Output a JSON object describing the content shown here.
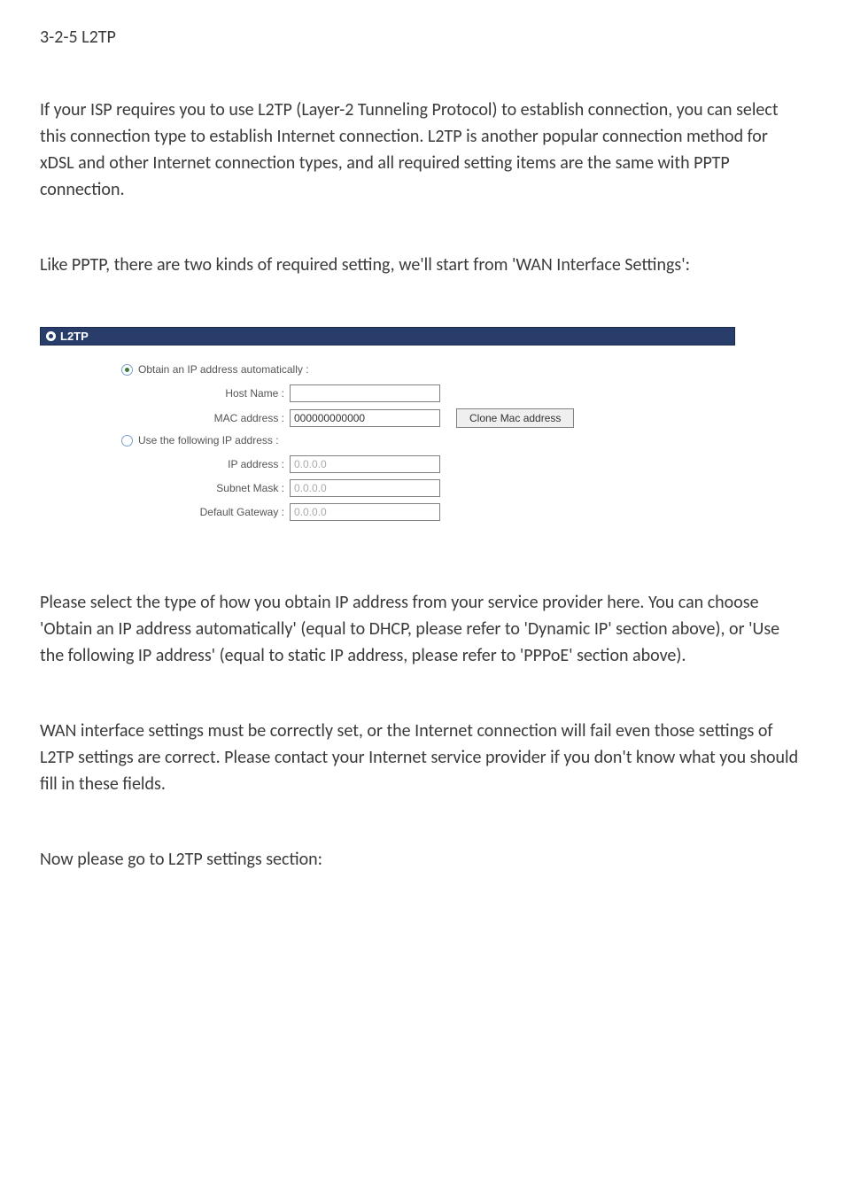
{
  "section_title": "3-2-5 L2TP",
  "para1": "If your ISP requires you to use L2TP (Layer-2 Tunneling Protocol) to establish connection, you can select this connection type to establish Internet connection. L2TP is another popular connection method for xDSL and other Internet connection types, and all required setting items are the same with PPTP connection.",
  "para2": "Like PPTP, there are two kinds of required setting, we'll start from 'WAN Interface Settings':",
  "para3": "Please select the type of how you obtain IP address from your service provider here. You can choose 'Obtain an IP address automatically' (equal to DHCP, please refer to 'Dynamic IP' section above), or 'Use the following IP address' (equal to static IP address, please refer to 'PPPoE' section above).",
  "para4": "WAN interface settings must be correctly set, or the Internet connection will fail even those settings of L2TP settings are correct. Please contact your Internet service provider if you don't know what you should fill in these fields.",
  "para5": "Now please go to L2TP settings section:",
  "screenshot": {
    "header": "L2TP",
    "radio1_label": "Obtain an IP address automatically :",
    "radio2_label": "Use the following IP address :",
    "hostname_label": "Host Name :",
    "hostname_value": "",
    "mac_label": "MAC address :",
    "mac_value": "000000000000",
    "clone_btn": "Clone Mac address",
    "ip_label": "IP address :",
    "ip_value": "0.0.0.0",
    "subnet_label": "Subnet Mask :",
    "subnet_value": "0.0.0.0",
    "gateway_label": "Default Gateway :",
    "gateway_value": "0.0.0.0"
  }
}
